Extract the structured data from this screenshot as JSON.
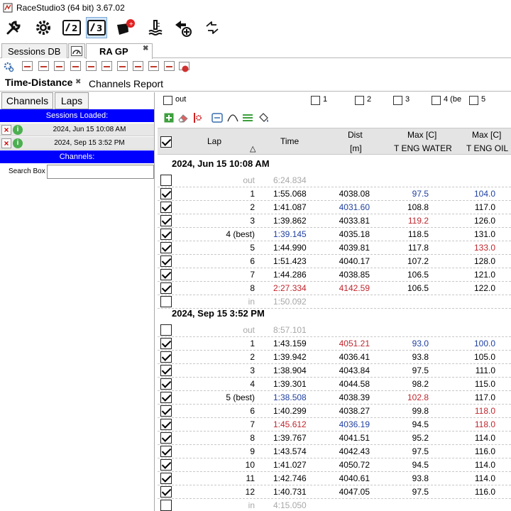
{
  "window": {
    "title": "RaceStudio3 (64 bit) 3.67.02"
  },
  "colors": {
    "accent_blue": "#0000ff",
    "best_blue": "#1f3fa0",
    "worst_red": "#c0262d",
    "grayed": "#a8a8a8"
  },
  "toolbar": {
    "icons": [
      "wrench-icon",
      "gear-icon",
      "mychron2-icon",
      "mychron3-icon",
      "alert-device-icon",
      "temperature-icon",
      "add-device-icon",
      "transfer-icon"
    ]
  },
  "session_tabs": [
    {
      "label": "Sessions DB"
    },
    {
      "label": "RA GP",
      "active": true
    }
  ],
  "view_tabs": [
    {
      "label": "Time-Distance",
      "active": true
    },
    {
      "label": "Channels Report"
    }
  ],
  "left_panel": {
    "channels_button": "Channels",
    "laps_button": "Laps",
    "sessions_loaded_header": "Sessions Loaded:",
    "sessions": [
      "2024, Jun 15 10:08 AM",
      "2024, Sep 15 3:52 PM"
    ],
    "channels_header": "Channels:",
    "search_label": "Search Box",
    "search_value": ""
  },
  "filters": [
    "out",
    "1",
    "2",
    "3",
    "4 (be",
    "5"
  ],
  "columns": {
    "lap": "Lap",
    "time": "Time",
    "dist": "Dist",
    "dist_unit": "[m]",
    "water_top": "Max [C]",
    "water_bottom": "T ENG WATER",
    "oil_top": "Max [C]",
    "oil_bottom": "T ENG OIL"
  },
  "sections": [
    {
      "title": "2024, Jun 15 10:08 AM",
      "rows": [
        {
          "checked": false,
          "lap": "out",
          "time": "6:24.834",
          "dist": "",
          "water": "",
          "oil": "",
          "lap_c": "gray",
          "time_c": "gray"
        },
        {
          "checked": true,
          "lap": "1",
          "time": "1:55.068",
          "dist": "4038.08",
          "water": "97.5",
          "oil": "104.0",
          "water_c": "blue",
          "oil_c": "blue"
        },
        {
          "checked": true,
          "lap": "2",
          "time": "1:41.087",
          "dist": "4031.60",
          "water": "108.8",
          "oil": "117.0",
          "dist_c": "blue"
        },
        {
          "checked": true,
          "lap": "3",
          "time": "1:39.862",
          "dist": "4033.81",
          "water": "119.2",
          "oil": "126.0",
          "water_c": "red"
        },
        {
          "checked": true,
          "lap": "4 (best)",
          "time": "1:39.145",
          "dist": "4035.18",
          "water": "118.5",
          "oil": "131.0",
          "time_c": "blue"
        },
        {
          "checked": true,
          "lap": "5",
          "time": "1:44.990",
          "dist": "4039.81",
          "water": "117.8",
          "oil": "133.0",
          "oil_c": "red"
        },
        {
          "checked": true,
          "lap": "6",
          "time": "1:51.423",
          "dist": "4040.17",
          "water": "107.2",
          "oil": "128.0"
        },
        {
          "checked": true,
          "lap": "7",
          "time": "1:44.286",
          "dist": "4038.85",
          "water": "106.5",
          "oil": "121.0"
        },
        {
          "checked": true,
          "lap": "8",
          "time": "2:27.334",
          "dist": "4142.59",
          "water": "106.5",
          "oil": "122.0",
          "time_c": "red",
          "dist_c": "red"
        },
        {
          "checked": false,
          "lap": "in",
          "time": "1:50.092",
          "dist": "",
          "water": "",
          "oil": "",
          "lap_c": "gray",
          "time_c": "gray"
        }
      ]
    },
    {
      "title": "2024, Sep 15 3:52 PM",
      "rows": [
        {
          "checked": false,
          "lap": "out",
          "time": "8:57.101",
          "dist": "",
          "water": "",
          "oil": "",
          "lap_c": "gray",
          "time_c": "gray"
        },
        {
          "checked": true,
          "lap": "1",
          "time": "1:43.159",
          "dist": "4051.21",
          "water": "93.0",
          "oil": "100.0",
          "dist_c": "red",
          "water_c": "blue",
          "oil_c": "blue"
        },
        {
          "checked": true,
          "lap": "2",
          "time": "1:39.942",
          "dist": "4036.41",
          "water": "93.8",
          "oil": "105.0"
        },
        {
          "checked": true,
          "lap": "3",
          "time": "1:38.904",
          "dist": "4043.84",
          "water": "97.5",
          "oil": "111.0"
        },
        {
          "checked": true,
          "lap": "4",
          "time": "1:39.301",
          "dist": "4044.58",
          "water": "98.2",
          "oil": "115.0"
        },
        {
          "checked": true,
          "lap": "5 (best)",
          "time": "1:38.508",
          "dist": "4038.39",
          "water": "102.8",
          "oil": "117.0",
          "time_c": "blue",
          "water_c": "red"
        },
        {
          "checked": true,
          "lap": "6",
          "time": "1:40.299",
          "dist": "4038.27",
          "water": "99.8",
          "oil": "118.0",
          "oil_c": "red"
        },
        {
          "checked": true,
          "lap": "7",
          "time": "1:45.612",
          "dist": "4036.19",
          "water": "94.5",
          "oil": "118.0",
          "time_c": "red",
          "dist_c": "blue",
          "oil_c": "red"
        },
        {
          "checked": true,
          "lap": "8",
          "time": "1:39.767",
          "dist": "4041.51",
          "water": "95.2",
          "oil": "114.0"
        },
        {
          "checked": true,
          "lap": "9",
          "time": "1:43.574",
          "dist": "4042.43",
          "water": "97.5",
          "oil": "116.0"
        },
        {
          "checked": true,
          "lap": "10",
          "time": "1:41.027",
          "dist": "4050.72",
          "water": "94.5",
          "oil": "114.0"
        },
        {
          "checked": true,
          "lap": "11",
          "time": "1:42.746",
          "dist": "4040.61",
          "water": "93.8",
          "oil": "114.0"
        },
        {
          "checked": true,
          "lap": "12",
          "time": "1:40.731",
          "dist": "4047.05",
          "water": "97.5",
          "oil": "116.0"
        },
        {
          "checked": false,
          "lap": "in",
          "time": "4:15.050",
          "dist": "",
          "water": "",
          "oil": "",
          "lap_c": "gray",
          "time_c": "gray"
        }
      ]
    }
  ]
}
